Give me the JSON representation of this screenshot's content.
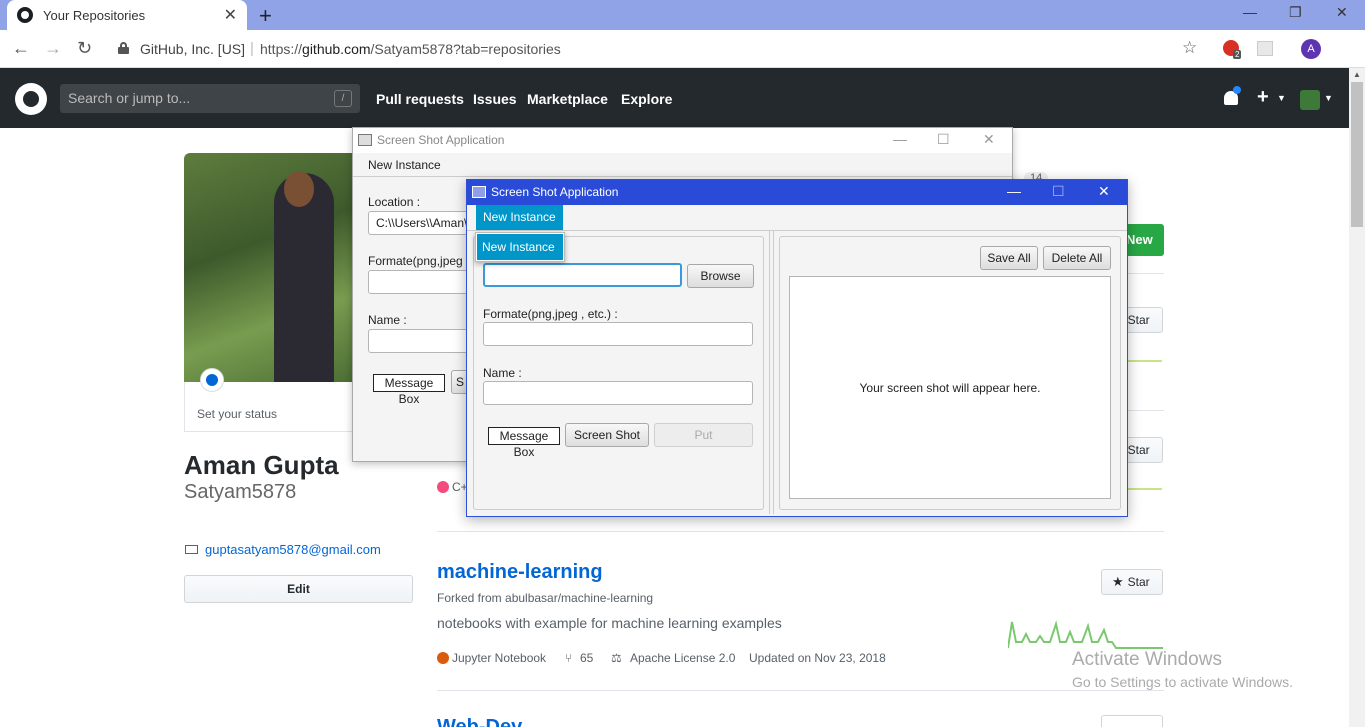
{
  "browser": {
    "tab_title": "Your Repositories",
    "org": "GitHub, Inc. [US]",
    "url_prefix": "https://",
    "url_domain": "github.com",
    "url_path": "/Satyam5878?tab=repositories",
    "ext_badge": "2",
    "account_initial": "A"
  },
  "github": {
    "search_placeholder": "Search or jump to...",
    "search_key": "/",
    "nav": [
      "Pull requests",
      "Issues",
      "Marketplace",
      "Explore"
    ]
  },
  "profile": {
    "status": "Set your status",
    "fullname": "Aman Gupta",
    "username": "Satyam5878",
    "email": "guptasatyam5878@gmail.com",
    "edit_label": "Edit"
  },
  "repos": {
    "count": "14",
    "new_label": "New",
    "star_label": "Star",
    "lang_partial": "C+",
    "repo": {
      "name": "machine-learning",
      "forked": "Forked from abulbasar/machine-learning",
      "description": "notebooks with example for machine learning examples",
      "language": "Jupyter Notebook",
      "language_color": "#DA5B0B",
      "forks": "65",
      "license": "Apache License 2.0",
      "updated": "Updated on Nov 23, 2018"
    },
    "next_repo_partial": "Web-Dev"
  },
  "back_window": {
    "title": "Screen Shot Application",
    "menu": "New Instance",
    "location_label": "Location :",
    "location_value": "C:\\\\Users\\\\Aman\\",
    "format_label": "Formate(png,jpeg",
    "name_label": "Name :",
    "msg_btn": "Message Box",
    "s_partial": "S"
  },
  "front_window": {
    "title": "Screen Shot Application",
    "menu": "New Instance",
    "dropdown_item": "New Instance",
    "browse_btn": "Browse",
    "format_label": "Formate(png,jpeg , etc.) :",
    "name_label": "Name :",
    "msg_btn": "Message Box",
    "shot_btn": "Screen Shot",
    "put_btn": "Put",
    "save_all": "Save All",
    "delete_all": "Delete All",
    "placeholder": "Your screen shot will appear here."
  },
  "windows_notice": {
    "title": "Activate Windows",
    "subtitle": "Go to Settings to activate Windows."
  },
  "colors": {
    "github_header": "#24292e",
    "link": "#0366d6",
    "new_button": "#28a745",
    "fx_accent": "#0096c9",
    "front_title_bar": "#2a4bd7",
    "cpp_dot": "#f34b7d"
  }
}
